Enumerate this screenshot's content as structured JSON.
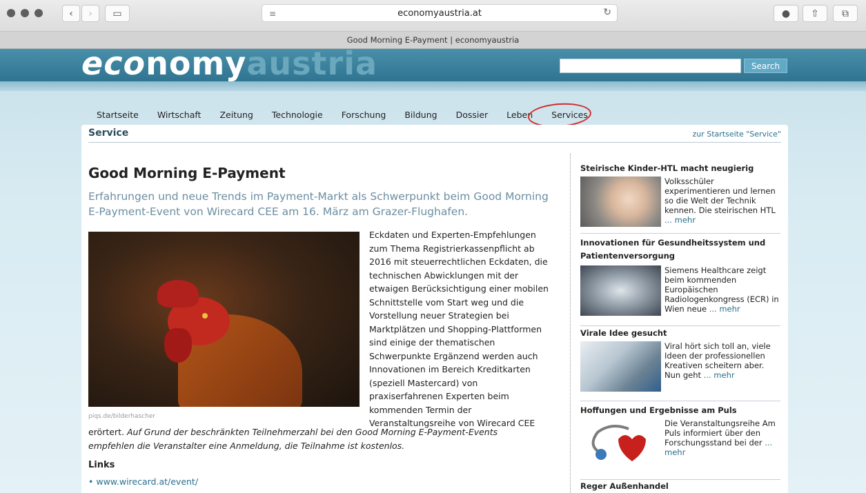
{
  "browser": {
    "url": "economyaustria.at",
    "tab_title": "Good Morning E-Payment | economyaustria"
  },
  "site": {
    "logo_part1": "eco",
    "logo_part2": "nomy",
    "logo_part3": "austria",
    "search_label": "Search"
  },
  "nav": [
    "Startseite",
    "Wirtschaft",
    "Zeitung",
    "Technologie",
    "Forschung",
    "Bildung",
    "Dossier",
    "Leben",
    "Services"
  ],
  "section": {
    "title": "Service",
    "link": "zur Startseite \"Service\""
  },
  "article": {
    "title": "Good Morning E-Payment",
    "lead": "Erfahrungen und neue Trends im Payment-Markt als Schwerpunkt beim Good Morning E-Payment-Event von Wirecard CEE am 16. März am Grazer-Flughafen.",
    "photo_caption": "piqs.de/bilderhascher",
    "body": "Eckdaten und Experten-Empfehlungen zum Thema Registrierkassenpflicht ab 2016 mit steuerrechtlichen Eckdaten, die technischen Abwicklungen mit der etwaigen Berücksichtigung einer mobilen Schnittstelle vom Start weg und die Vorstellung neuer Strategien bei Marktplätzen und Shopping-Plattformen sind einige der thematischen Schwerpunkte Ergänzend werden auch Innovationen im Bereich Kreditkarten (speziell Mastercard) von praxiserfahrenen Experten beim kommenden Termin der Veranstaltungsreihe von Wirecard CEE",
    "body_cont": "erörtert.",
    "body_italic": "Auf Grund der beschränkten Teilnehmerzahl bei den Good Morning E-Payment-Events empfehlen die Veranstalter eine Anmeldung, die Teilnahme ist kostenlos.",
    "links_heading": "Links",
    "link1": "• www.wirecard.at/event/"
  },
  "sidebar": [
    {
      "title": "Steirische Kinder-HTL macht neugierig",
      "text": "Volksschüler experimentieren und lernen so die Welt der Technik kennen. Die steirischen HTL",
      "more": "... mehr"
    },
    {
      "title": "Innovationen für Gesundheitssystem und Patientenversorgung",
      "text": "Siemens Healthcare zeigt beim kommenden Europäischen Radiologenkongress (ECR) in Wien neue",
      "more": "... mehr"
    },
    {
      "title": "Virale Idee gesucht",
      "text": "Viral hört sich toll an, viele Ideen der professionellen Kreativen scheitern aber. Nun geht",
      "more": "... mehr"
    },
    {
      "title": "Hoffungen und Ergebnisse am Puls",
      "text": "Die Veranstaltungsreihe Am Puls informiert über den Forschungsstand bei der",
      "more": "... mehr"
    },
    {
      "title": "Reger Außenhandel",
      "text": "",
      "more": ""
    }
  ]
}
